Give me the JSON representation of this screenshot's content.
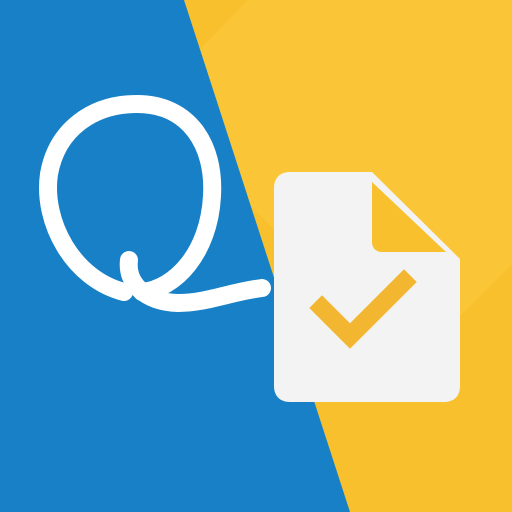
{
  "icon": {
    "logo_letter": "Q",
    "symbols": [
      "q-logo",
      "document-icon",
      "checkmark-icon"
    ]
  },
  "colors": {
    "blue_panel": "#1780C6",
    "yellow_panel": "#F9C02E",
    "yellow_highlight": "#FBC83E",
    "logo": "#FFFFFF",
    "document": "#F3F3F3",
    "document_fold": "#F9C02E",
    "checkmark": "#F2B631"
  }
}
